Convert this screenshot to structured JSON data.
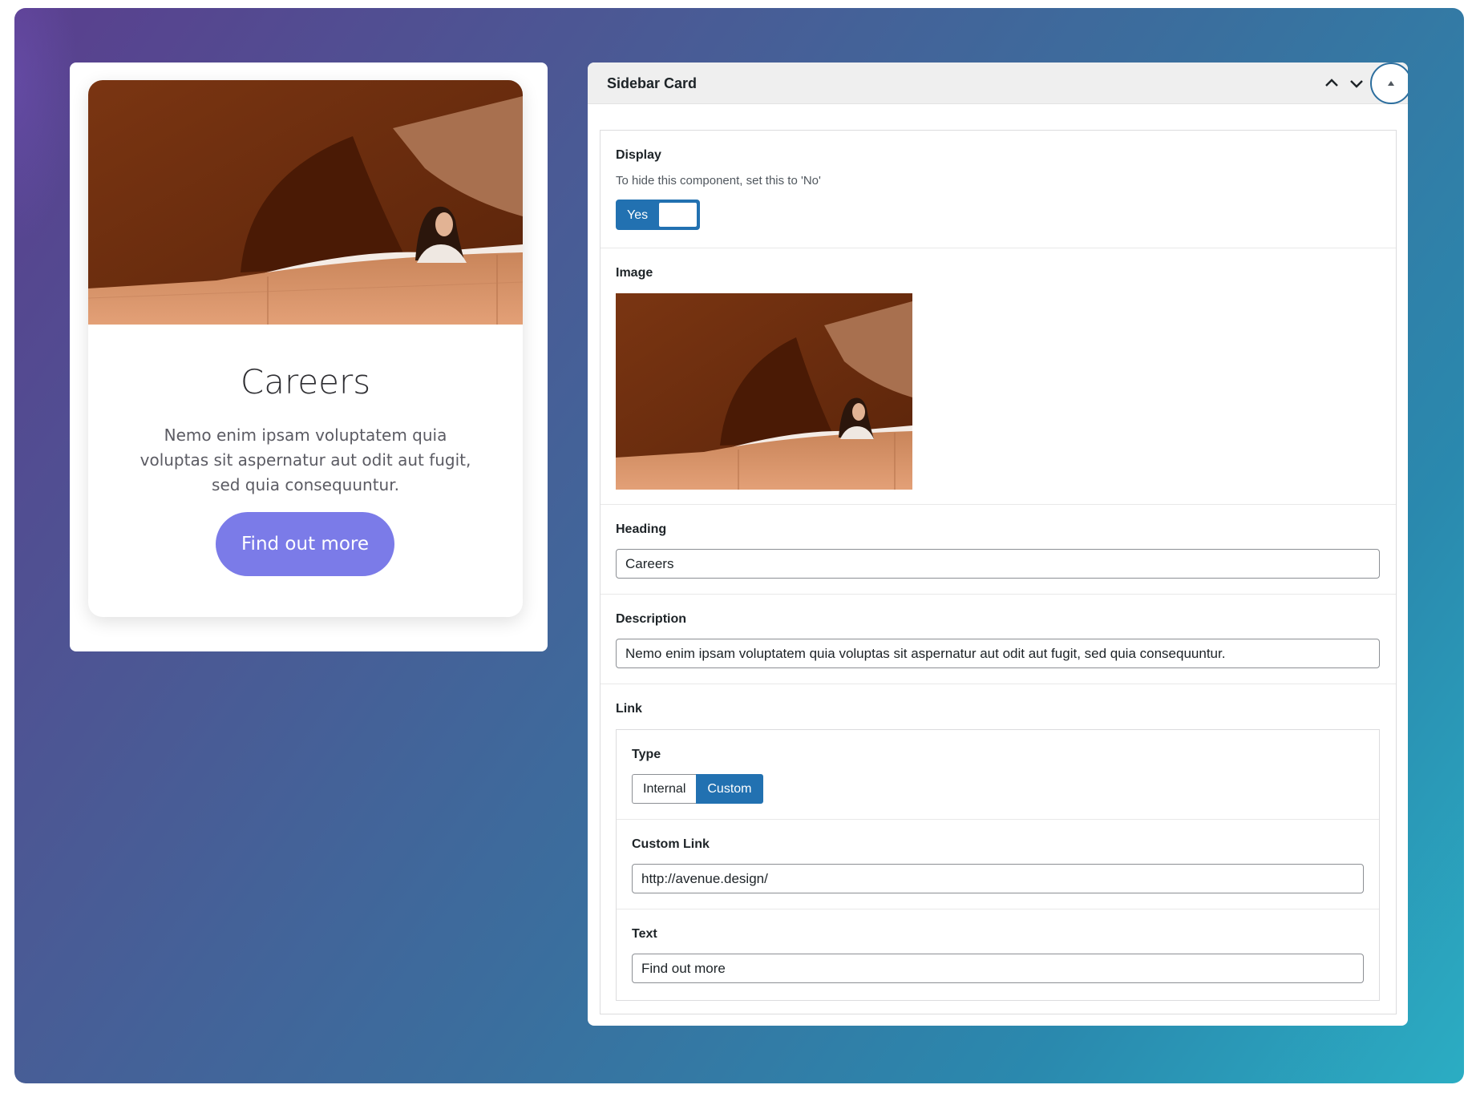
{
  "preview": {
    "title": "Careers",
    "description": "Nemo enim ipsam voluptatem quia voluptas sit aspernatur aut odit aut fugit, sed quia consequuntur.",
    "button_label": "Find out more",
    "button_color": "#7b7be8"
  },
  "panel": {
    "title": "Sidebar Card",
    "icons": {
      "move_up": "chevron-up-icon",
      "move_down": "chevron-down-icon",
      "collapse": "triangle-up-icon"
    },
    "display": {
      "label": "Display",
      "help": "To hide this component, set this to 'No'",
      "toggle_value": "Yes"
    },
    "image": {
      "label": "Image"
    },
    "heading": {
      "label": "Heading",
      "value": "Careers"
    },
    "description": {
      "label": "Description",
      "value": "Nemo enim ipsam voluptatem quia voluptas sit aspernatur aut odit aut fugit, sed quia consequuntur."
    },
    "link": {
      "label": "Link",
      "type": {
        "label": "Type",
        "options": [
          "Internal",
          "Custom"
        ],
        "selected": "Custom"
      },
      "custom_link": {
        "label": "Custom Link",
        "value": "http://avenue.design/"
      },
      "text": {
        "label": "Text",
        "value": "Find out more"
      }
    }
  },
  "colors": {
    "accent": "#2271b1",
    "button": "#7b7be8"
  }
}
